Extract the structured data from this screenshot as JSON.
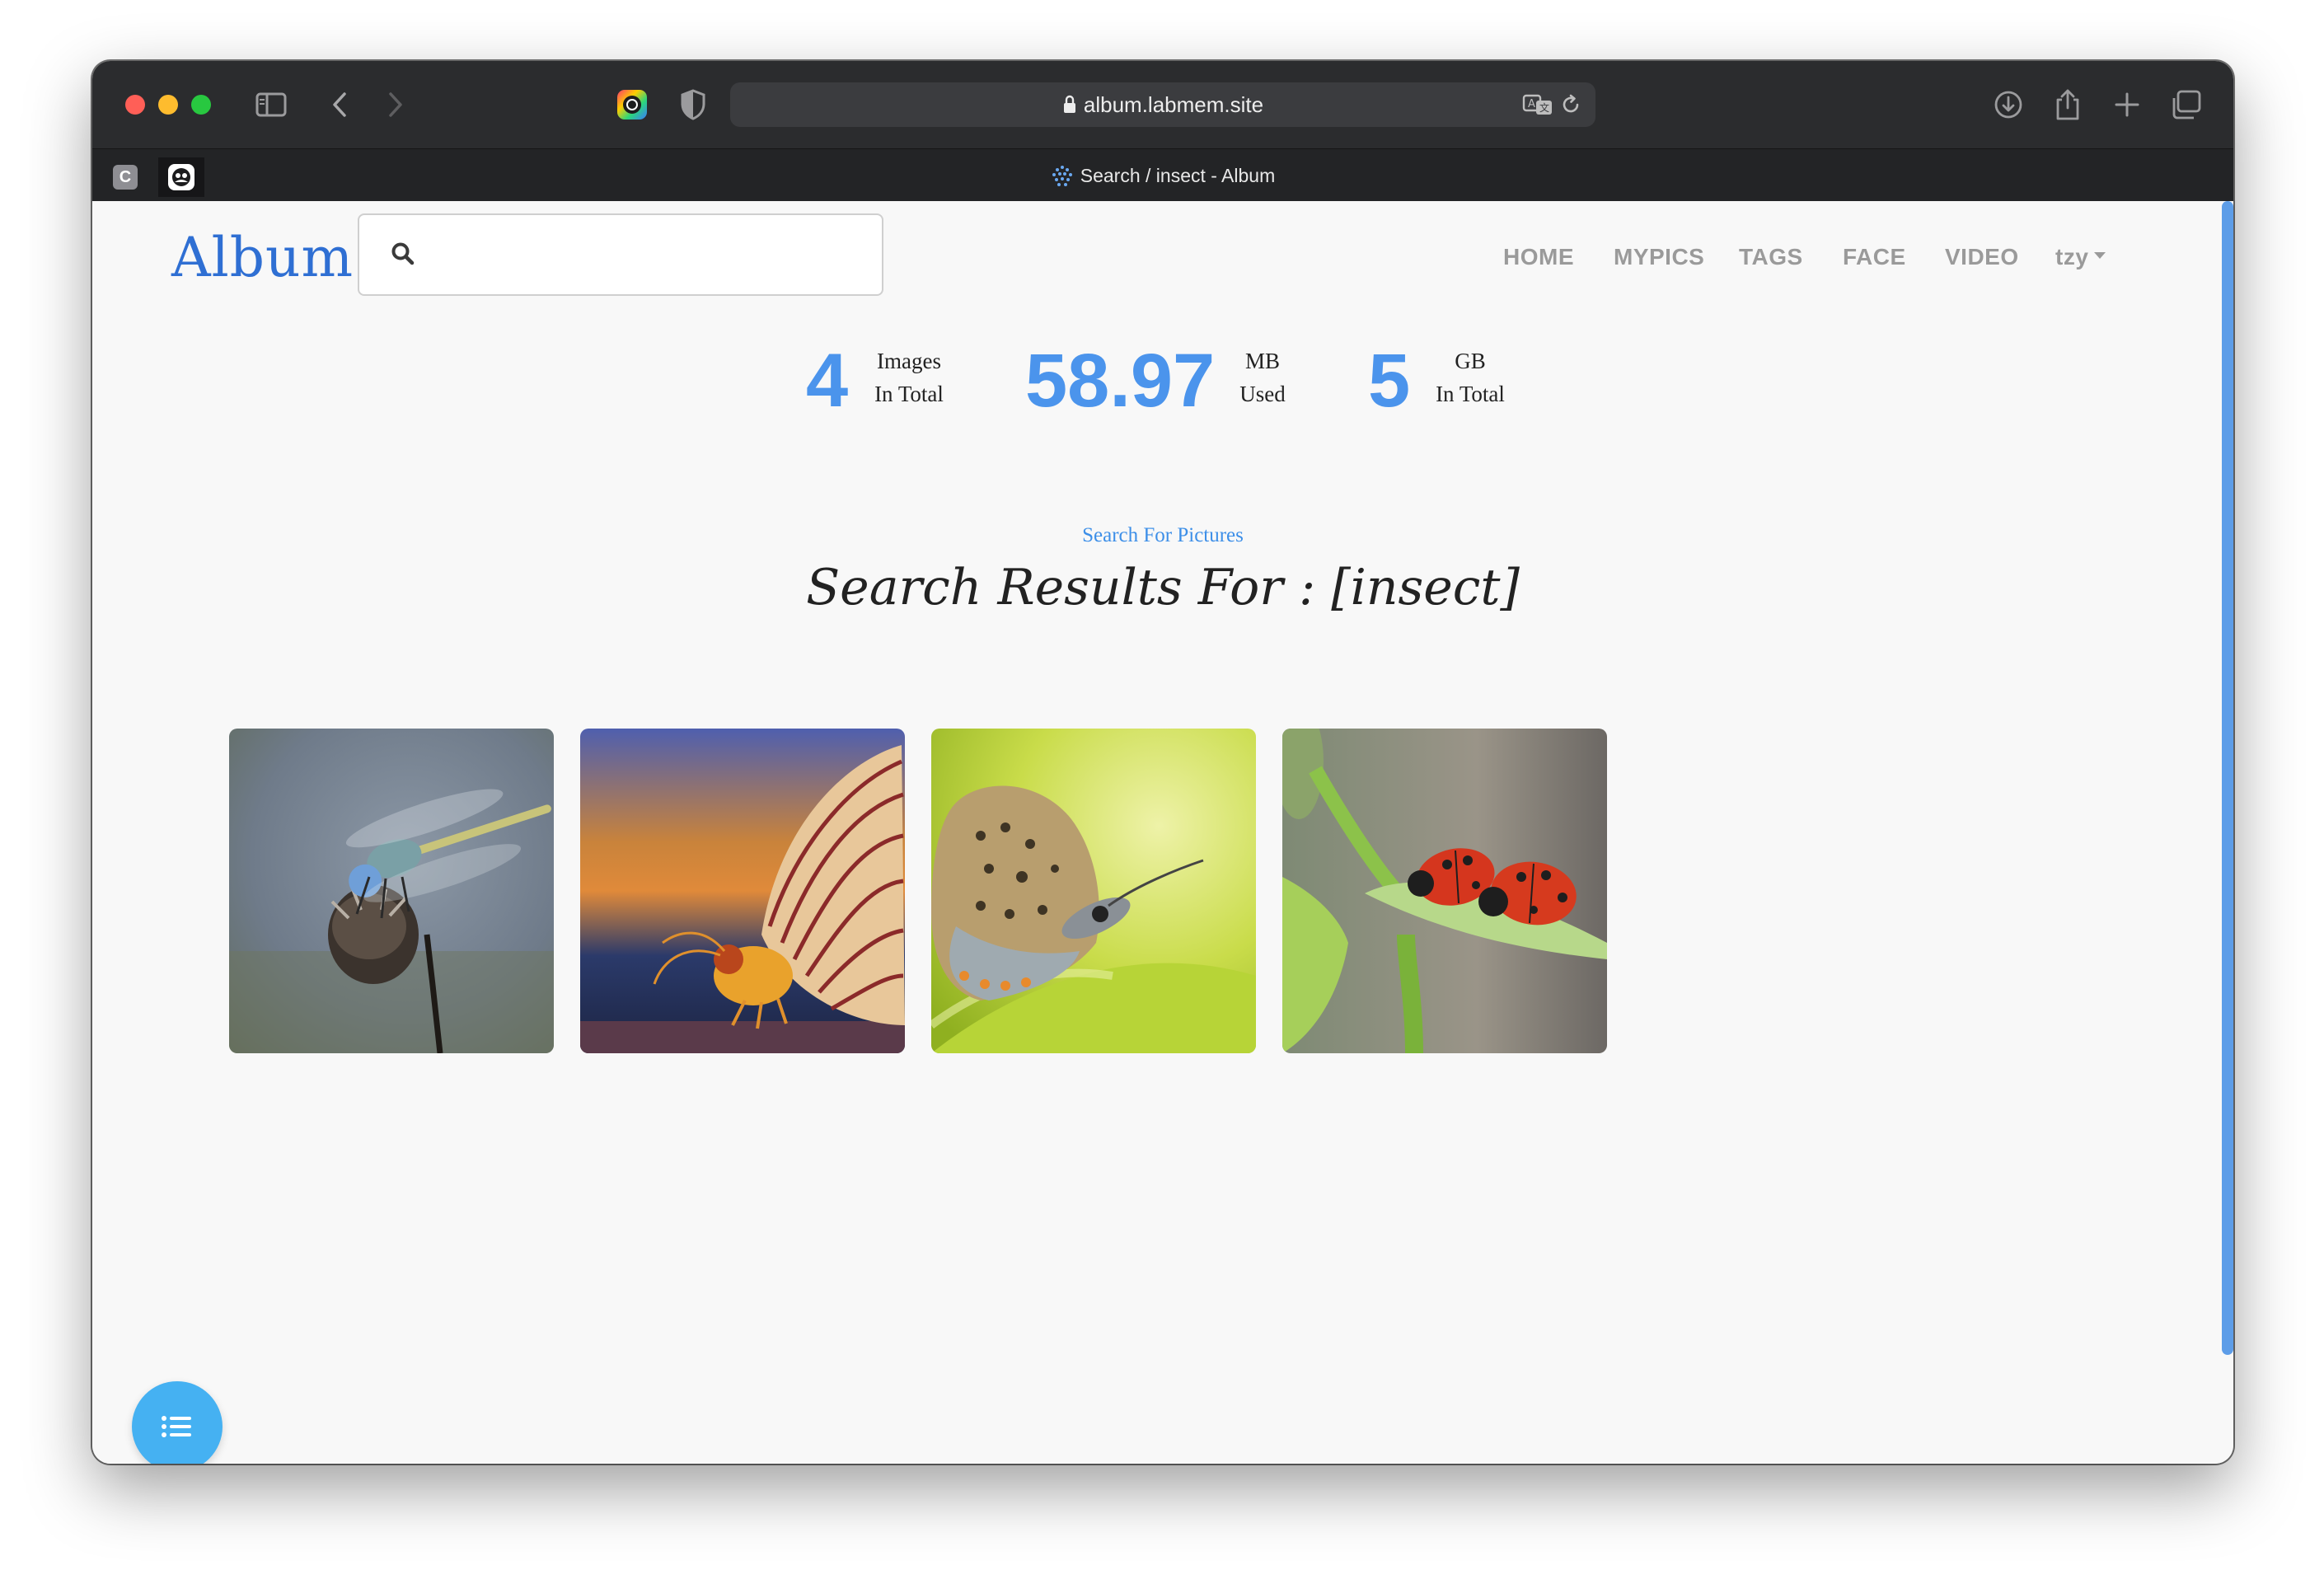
{
  "browser": {
    "url": "album.labmem.site",
    "tab_title": "Search / insect - Album",
    "pinned_tab_1": "C"
  },
  "site": {
    "logo": "Album",
    "search": {
      "value": "",
      "placeholder": ""
    },
    "nav": [
      {
        "label": "HOME"
      },
      {
        "label": "MYPICS"
      },
      {
        "label": "TAGS"
      },
      {
        "label": "FACE"
      },
      {
        "label": "VIDEO"
      },
      {
        "label": "tzy"
      }
    ]
  },
  "stats": [
    {
      "value": "4",
      "line1": "Images",
      "line2": "In Total"
    },
    {
      "value": "58.97",
      "line1": "MB",
      "line2": "Used"
    },
    {
      "value": "5",
      "line1": "GB",
      "line2": "In Total"
    }
  ],
  "results": {
    "subtitle": "Search For Pictures",
    "heading": "Search Results For : [insect]",
    "images": [
      {
        "subject": "dragonfly"
      },
      {
        "subject": "moth"
      },
      {
        "subject": "butterfly"
      },
      {
        "subject": "ladybugs"
      }
    ]
  },
  "colors": {
    "accent": "#4b94ec",
    "fab": "#45b1f2",
    "logo": "#2f6fd3"
  }
}
